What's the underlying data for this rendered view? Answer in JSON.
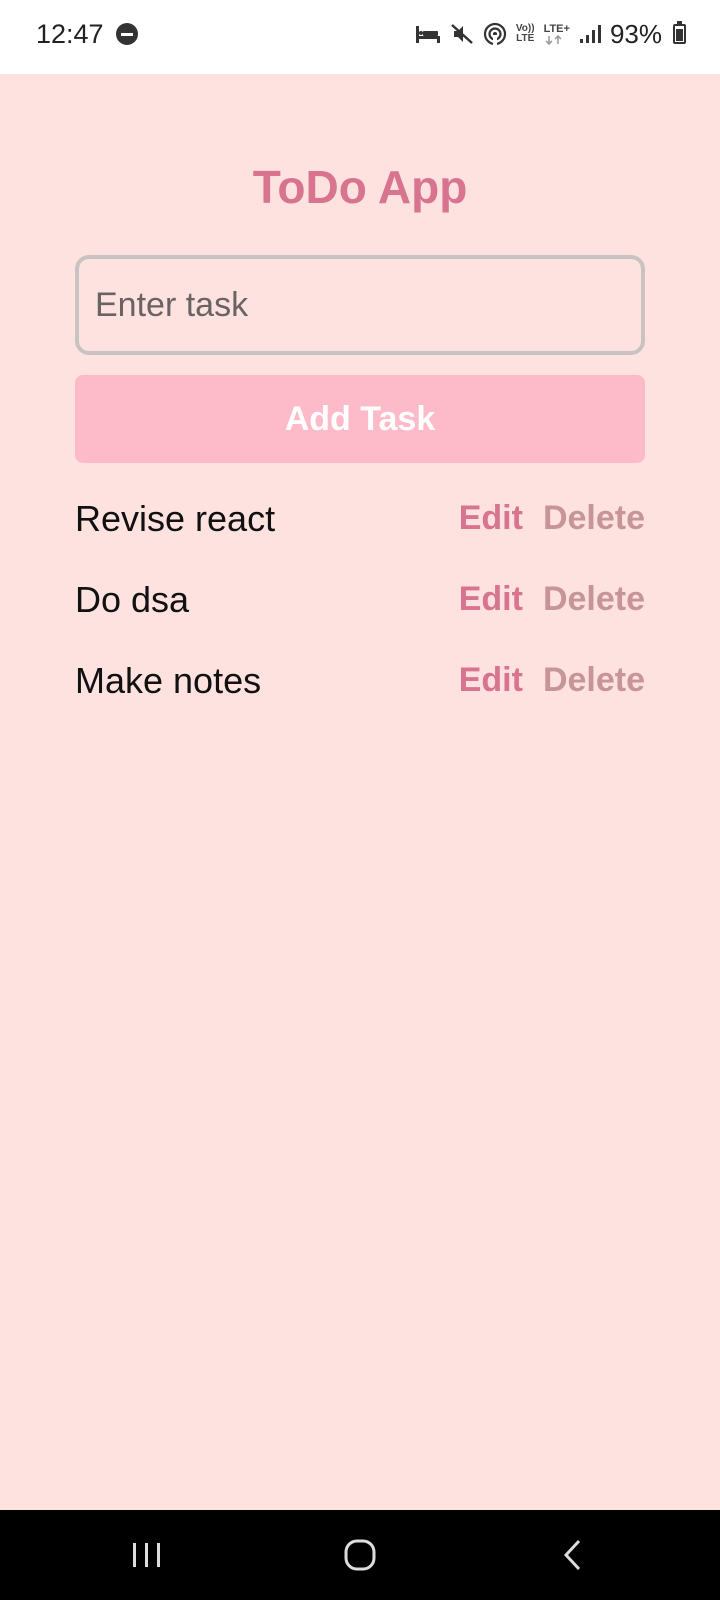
{
  "status_bar": {
    "time": "12:47",
    "volte_top": "Vo))",
    "volte_bottom": "LTE",
    "lte_label": "LTE+",
    "battery_percent": "93%",
    "icons": [
      "do-not-disturb-icon",
      "sleep-bed-icon",
      "mute-icon",
      "hotspot-icon",
      "volte-icon",
      "lte-plus-icon",
      "signal-icon",
      "battery-charging-icon"
    ]
  },
  "app": {
    "title": "ToDo App",
    "input": {
      "placeholder": "Enter task",
      "value": ""
    },
    "add_button_label": "Add Task",
    "tasks": [
      {
        "text": "Revise react",
        "edit_label": "Edit",
        "delete_label": "Delete"
      },
      {
        "text": "Do dsa",
        "edit_label": "Edit",
        "delete_label": "Delete"
      },
      {
        "text": "Make notes",
        "edit_label": "Edit",
        "delete_label": "Delete"
      }
    ]
  },
  "nav_bar": {
    "icons": [
      "recent-apps-icon",
      "home-icon",
      "back-icon"
    ]
  },
  "colors": {
    "background": "#fde2e0",
    "title": "#d87390",
    "add_button": "#fdbbc9",
    "edit": "#d87390",
    "delete": "#c79598",
    "input_border": "#c9c4c3"
  }
}
